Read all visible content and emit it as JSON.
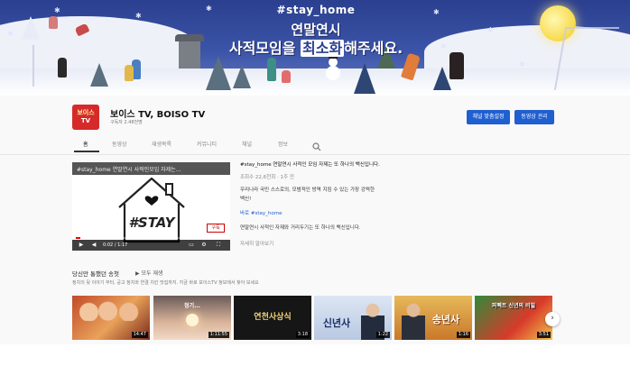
{
  "banner": {
    "hashtag": "#stay_home",
    "headline1": "연말연시",
    "headline2_pre": "사적모임을 ",
    "headline2_hl": "최소화",
    "headline2_post": "해주세요."
  },
  "channel": {
    "avatar_top": "보이스",
    "avatar_bottom": "TV",
    "name": "보이스 TV, BOISO TV",
    "subscribers": "구독자 2.48천명",
    "customize_label": "채널 맞춤설정",
    "manage_label": "동영상 관리"
  },
  "tabs": [
    "홈",
    "동영상",
    "재생목록",
    "커뮤니티",
    "채널",
    "정보"
  ],
  "featured": {
    "title": "#stay_home 연말연시 사적인모임 자제는…",
    "time": "0:02 / 1:17",
    "subscribe_badge": "구독",
    "progress": 0.03,
    "description": [
      "#stay_home 연말연시 사적인 모임 자제는 또 하나의 백신입니다.",
      "조회수 22,6천회 · 1주 전",
      "우리나라 국민 스스로의, 모범적인 방역 지킴 수 있는 가장 강력한",
      "백신!",
      "바로 #stay_home",
      "연말연시 사적인 자제와 거리두기는 또 하나의 백신입니다.",
      "자세히 알아보기"
    ]
  },
  "shelf": {
    "title": "당신만 통했던 송첫",
    "play_all": "▶ 모두 재생",
    "subtitle": "정치의 뒷 이야기 부터, 공고 정치와 연결 치킨 맛집까지. 지금 바로 보이스TV 정보에서 찾아 보세요",
    "thumbs": [
      {
        "duration": "14:47",
        "text": ""
      },
      {
        "duration": "1:11:55",
        "text": "정기..."
      },
      {
        "duration": "3:18",
        "text": "연천사상식"
      },
      {
        "duration": "1:22",
        "text": "신년사"
      },
      {
        "duration": "1:16",
        "text": "송년사"
      },
      {
        "duration": "3:51",
        "text": "퍼펙트 신년의 비밀"
      }
    ]
  }
}
